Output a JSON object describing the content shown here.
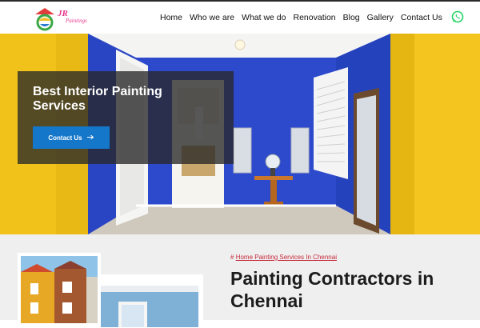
{
  "header": {
    "logo_text": "Paintings",
    "nav": [
      "Home",
      "Who we are",
      "What we do",
      "Renovation",
      "Blog",
      "Gallery",
      "Contact Us"
    ]
  },
  "hero": {
    "title": "Best Interior Painting Services",
    "button_label": "Contact Us",
    "button_icon": "arrow-right-icon"
  },
  "section": {
    "tag_icon": "#",
    "tag_text": "Home Painting Services In Chennai",
    "heading": "Painting Contractors in Chennai"
  },
  "colors": {
    "accent_blue": "#1577c9",
    "whatsapp_green": "#25d366",
    "tag_red": "#c6283b",
    "wall_blue": "#2b47c9",
    "wall_yellow": "#f0c419"
  }
}
